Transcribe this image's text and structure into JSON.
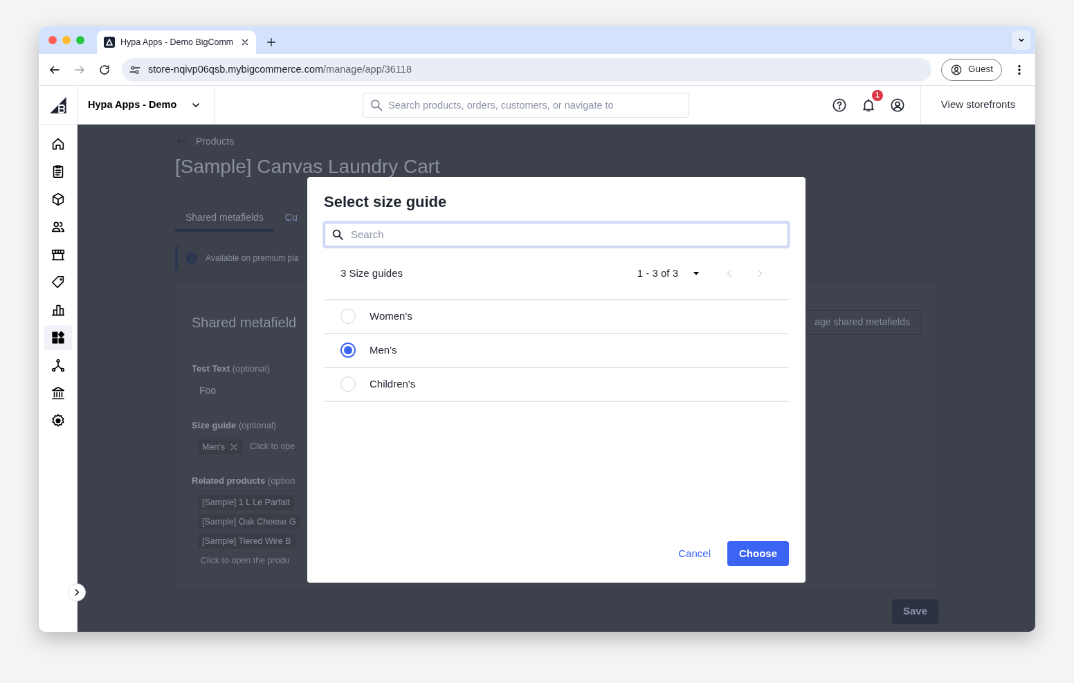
{
  "browser": {
    "tab_title": "Hypa Apps - Demo BigComm",
    "url_host": "store-nqivp06qsb.mybigcommerce.com",
    "url_path": "/manage/app/36118",
    "profile": "Guest"
  },
  "header": {
    "store_name": "Hypa Apps - Demo",
    "search_placeholder": "Search products, orders, customers, or navigate to",
    "notification_count": "1",
    "storefronts_link": "View storefronts"
  },
  "sidebar": {
    "items": [
      {
        "kind": "home",
        "selected": false
      },
      {
        "kind": "orders",
        "selected": false
      },
      {
        "kind": "products",
        "selected": false
      },
      {
        "kind": "customers",
        "selected": false
      },
      {
        "kind": "storefront",
        "selected": false
      },
      {
        "kind": "marketing",
        "selected": false
      },
      {
        "kind": "analytics",
        "selected": false
      },
      {
        "kind": "apps",
        "selected": true
      },
      {
        "kind": "channels",
        "selected": false
      },
      {
        "kind": "finance",
        "selected": false
      },
      {
        "kind": "settings",
        "selected": false
      }
    ]
  },
  "page": {
    "back_link": "Products",
    "title": "[Sample] Canvas Laundry Cart",
    "tabs": [
      {
        "label": "Shared metafields",
        "selected": true
      },
      {
        "label": "Cu",
        "selected": false
      }
    ],
    "notice": "Available on premium pla",
    "card": {
      "title": "Shared metafield",
      "manage_button": "age shared metafields",
      "fields": [
        {
          "kind": "text",
          "label": "**Test Text** (optional)",
          "value": "Foo"
        },
        {
          "kind": "chips",
          "label": "**Size guide** (optional)",
          "chips": [
            "Men's"
          ],
          "placeholder": "Click to ope"
        },
        {
          "kind": "list",
          "label": "**Related products** (option",
          "chips": [
            "[Sample] 1 L Le Parfait",
            "[Sample] Oak Cheese G",
            "[Sample] Tiered Wire B"
          ],
          "placeholder": "Click to open the produ"
        }
      ]
    },
    "save_button": "Save"
  },
  "modal": {
    "title": "Select size guide",
    "search_placeholder": "Search",
    "count": "3 Size guides",
    "range": "1 - 3 of 3",
    "prev_disabled": true,
    "next_disabled": true,
    "options": [
      {
        "label": "Women's",
        "selected": false
      },
      {
        "label": "Men's",
        "selected": true
      },
      {
        "label": "Children's",
        "selected": false
      }
    ],
    "cancel": "Cancel",
    "choose": "Choose"
  }
}
